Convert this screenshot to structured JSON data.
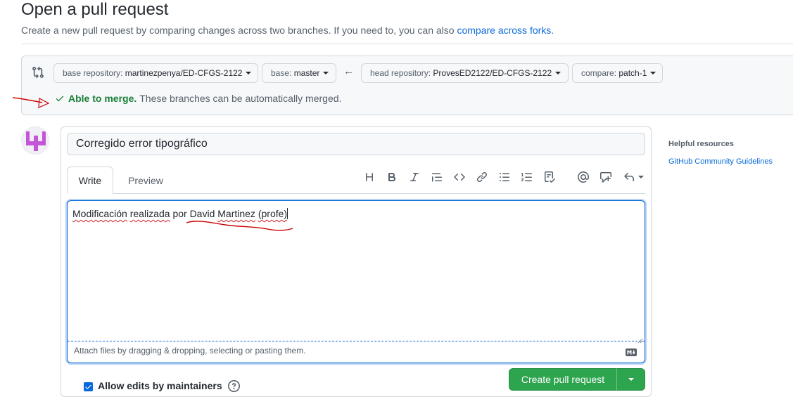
{
  "header": {
    "title": "Open a pull request",
    "description": "Create a new pull request by comparing changes across two branches. If you need to, you can also",
    "description_link": "compare across forks",
    "description_end": "."
  },
  "compare": {
    "base_repo_label": "base repository:",
    "base_repo_value": "martinezpenya/ED-CFGS-2122",
    "base_label": "base:",
    "base_value": "master",
    "head_repo_label": "head repository:",
    "head_repo_value": "ProvesED2122/ED-CFGS-2122",
    "compare_label": "compare:",
    "compare_value": "patch-1",
    "merge_status": "Able to merge.",
    "merge_message": "These branches can be automatically merged."
  },
  "form": {
    "title_value": "Corregido error tipográfico",
    "tabs": [
      "Write",
      "Preview"
    ],
    "body_words": [
      "Modificación",
      "realizada",
      "por",
      "David",
      "Martinez",
      "(profe)"
    ],
    "attach_text": "Attach files by dragging & dropping, selecting or pasting them.",
    "allow_edits_label": "Allow edits by maintainers",
    "allow_edits_checked": true,
    "create_button": "Create pull request",
    "toolbar_icons": [
      "heading-icon",
      "bold-icon",
      "italic-icon",
      "quote-icon",
      "code-icon",
      "link-icon",
      "unordered-list-icon",
      "ordered-list-icon",
      "task-list-icon",
      "mention-icon",
      "reference-icon",
      "reply-icon"
    ]
  },
  "sidebar": {
    "helpful_title": "Helpful resources",
    "link": "GitHub Community Guidelines"
  },
  "colors": {
    "accent": "#0969da",
    "success": "#1a7f37",
    "button_green": "#2da44e",
    "annotation_red": "#cc0000"
  }
}
